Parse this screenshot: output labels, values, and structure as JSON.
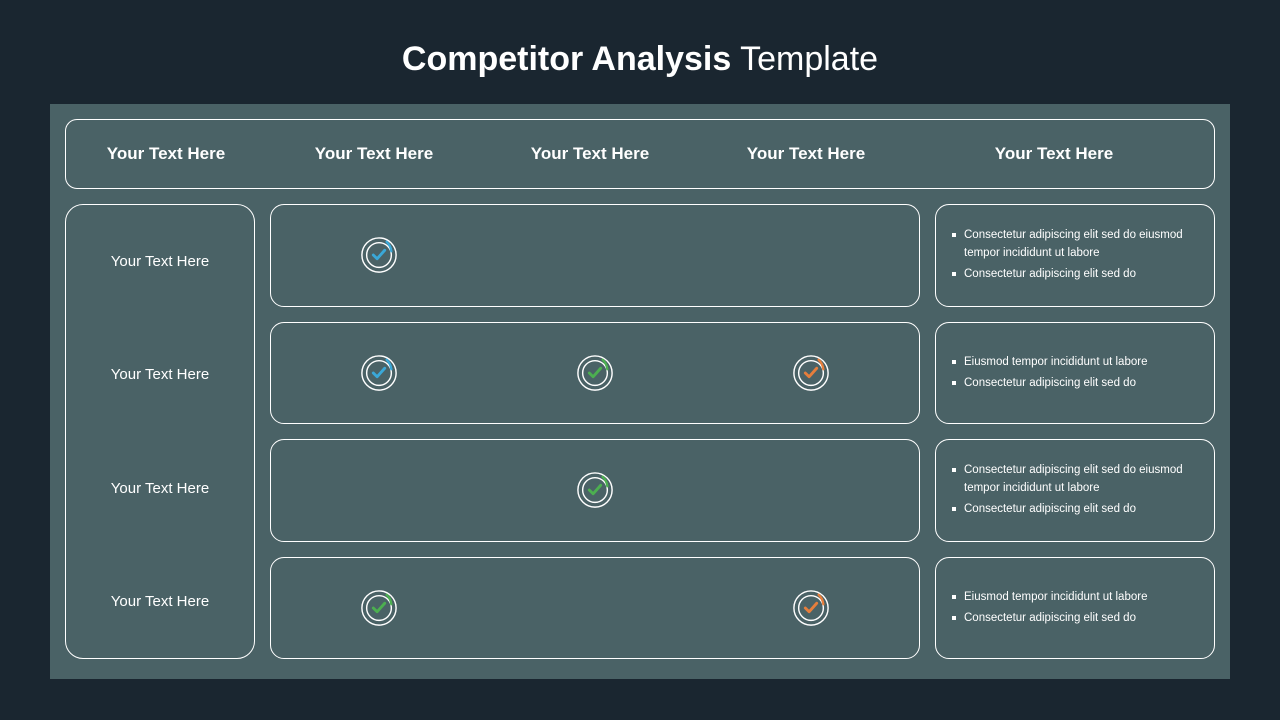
{
  "title": {
    "bold": "Competitor Analysis",
    "light": " Template"
  },
  "headers": [
    "Your Text Here",
    "Your Text Here",
    "Your Text Here",
    "Your Text Here",
    "Your Text Here"
  ],
  "side": [
    "Your Text Here",
    "Your Text Here",
    "Your Text Here",
    "Your Text Here"
  ],
  "rows": [
    {
      "checks": [
        "blue",
        null,
        null
      ],
      "notes": [
        "Consectetur adipiscing elit sed do eiusmod tempor incididunt ut labore",
        "Consectetur adipiscing elit sed do"
      ]
    },
    {
      "checks": [
        "blue",
        "green",
        "orange"
      ],
      "notes": [
        "Eiusmod tempor incididunt ut labore",
        "Consectetur adipiscing elit sed do"
      ]
    },
    {
      "checks": [
        null,
        "green",
        null
      ],
      "notes": [
        "Consectetur adipiscing elit sed do eiusmod tempor incididunt ut labore",
        "Consectetur adipiscing elit sed do"
      ]
    },
    {
      "checks": [
        "green",
        null,
        "orange"
      ],
      "notes": [
        "Eiusmod tempor incididunt ut labore",
        "Consectetur adipiscing elit sed do"
      ]
    }
  ],
  "colors": {
    "blue": "#3aa8d8",
    "green": "#4caf50",
    "orange": "#e67e3c"
  }
}
